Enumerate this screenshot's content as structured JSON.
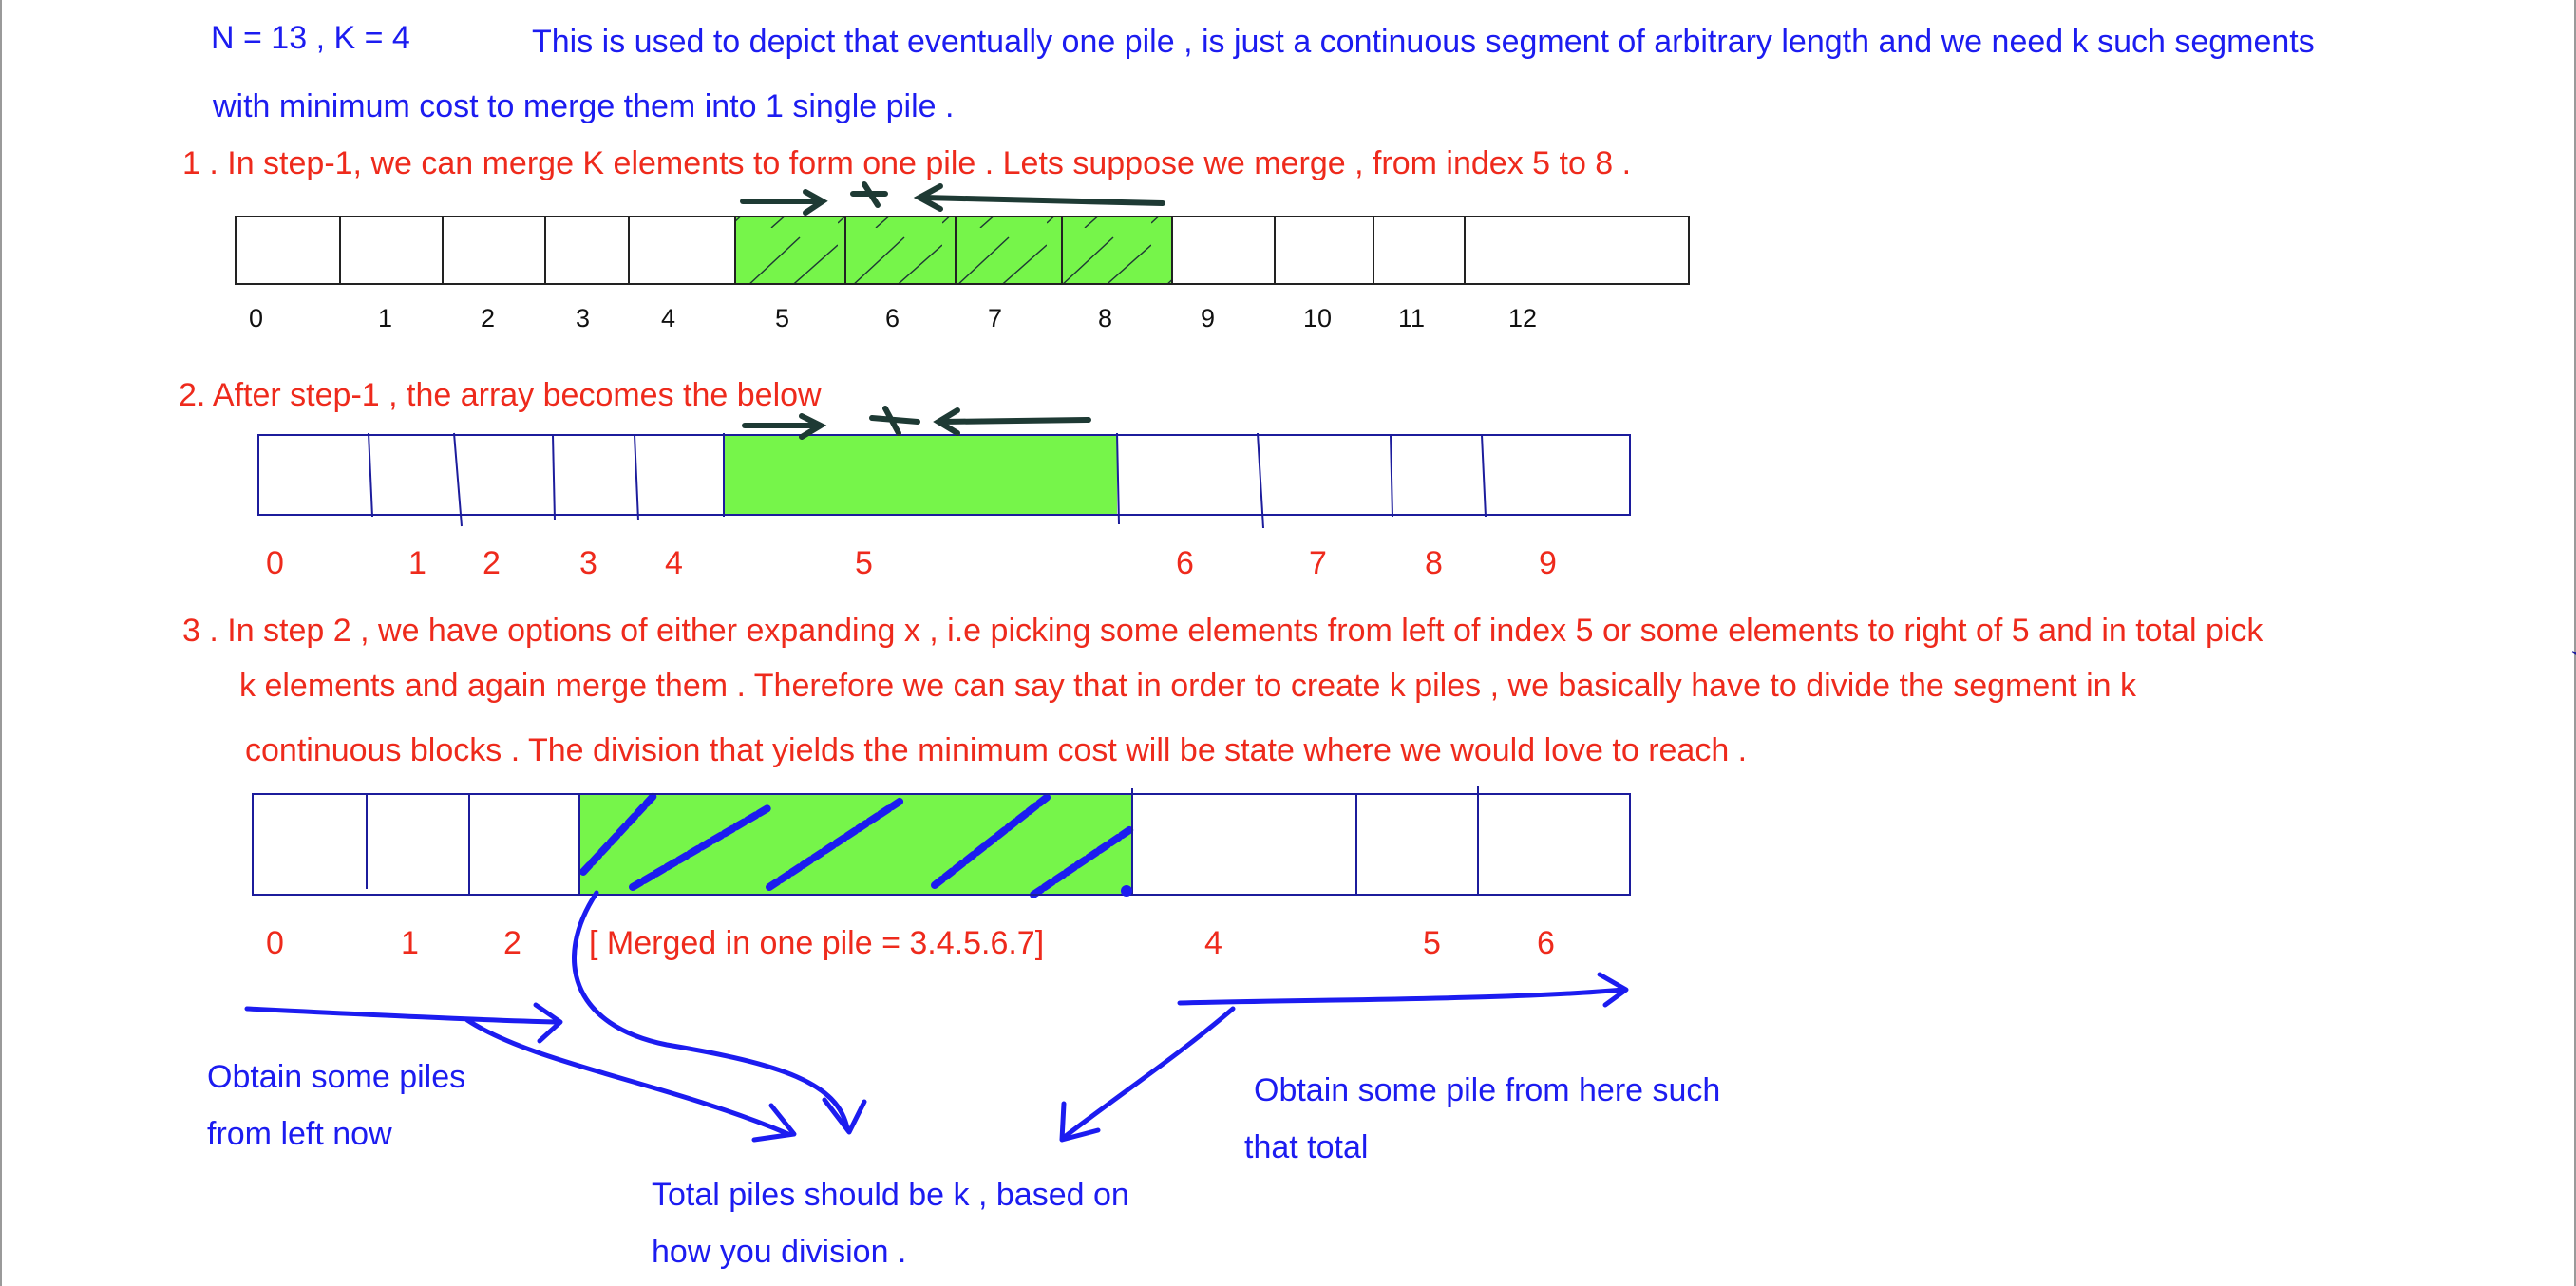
{
  "header": {
    "params": "N = 13       ,  K = 4",
    "line1": "This is used to depict that eventually one pile , is just a continuous segment of arbitrary length and we need k such segments",
    "line2": "with minimum cost to merge them into 1 single pile ."
  },
  "step1": {
    "text": "1 .  In step-1, we can merge K elements to form one pile . Lets suppose we merge , from index 5 to 8 .",
    "indices": [
      "0",
      "1",
      "2",
      "3",
      "4",
      "5",
      "6",
      "7",
      "8",
      "9",
      "10",
      "11",
      "12"
    ]
  },
  "step2": {
    "text": "2.  After step-1 , the array becomes the below",
    "x_mark": "x",
    "indices": [
      "0",
      "1",
      "2",
      "3",
      "4",
      "5",
      "6",
      "7",
      "8",
      "9"
    ]
  },
  "step3": {
    "line1": "3 .  In step 2 , we have options of either expanding x ,  i.e picking some elements from left of index 5 or some elements to right of 5 and in total pick",
    "line2": "k elements and again merge them . Therefore we can say that in order to create k piles , we basically have to divide the segment in k",
    "line3": "continuous blocks . The division that yields the minimum cost  will be        state where we would love to reach .",
    "left_indices": [
      "0",
      "1",
      "2"
    ],
    "merged_label": "[ Merged in one pile = 3.4.5.6.7]",
    "right_indices": [
      "4",
      "5",
      "6"
    ]
  },
  "notes": {
    "left_line1": "Obtain some piles",
    "left_line2": "from left now",
    "right_line1": "Obtain some pile from here such",
    "right_line2": "that total",
    "bottom_line1": "Total piles should be k , based on",
    "bottom_line2": "how you division ."
  },
  "colors": {
    "blue_text": "#1c1cf0",
    "red_text": "#ee2a1c",
    "green_fill": "#76f54a",
    "ink_dark": "#1e3a34",
    "array_border_1": "#222222",
    "array_border_2": "#1c1c9c"
  }
}
